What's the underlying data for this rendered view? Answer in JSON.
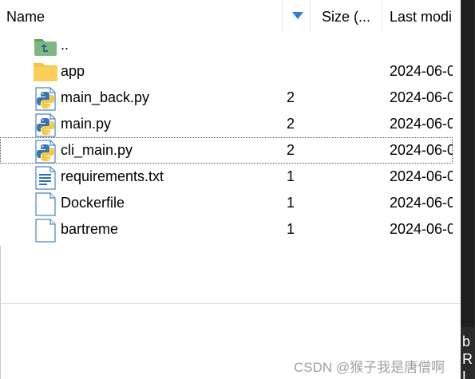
{
  "header": {
    "name_label": "Name",
    "size_label": "Size (...",
    "modified_label": "Last modi"
  },
  "files": [
    {
      "icon": "parent-folder-icon",
      "name": "..",
      "size": "",
      "modified": ""
    },
    {
      "icon": "folder-icon",
      "name": "app",
      "size": "",
      "modified": "2024-06-0"
    },
    {
      "icon": "python-file-icon",
      "name": "main_back.py",
      "size": "2",
      "modified": "2024-06-0"
    },
    {
      "icon": "python-file-icon",
      "name": "main.py",
      "size": "2",
      "modified": "2024-06-0"
    },
    {
      "icon": "python-file-icon",
      "name": "cli_main.py",
      "size": "2",
      "modified": "2024-06-0"
    },
    {
      "icon": "text-file-icon",
      "name": "requirements.txt",
      "size": "1",
      "modified": "2024-06-0"
    },
    {
      "icon": "blank-file-icon",
      "name": "Dockerfile",
      "size": "1",
      "modified": "2024-06-0"
    },
    {
      "icon": "blank-file-icon",
      "name": "bartreme",
      "size": "1",
      "modified": "2024-06-0"
    }
  ],
  "focused_index": 4,
  "side_text": [
    "b",
    "R",
    "L"
  ],
  "watermark": "CSDN @猴子我是唐僧啊",
  "colors": {
    "folder": "#f5c242",
    "python_blue": "#3a75b0",
    "python_yellow": "#f7c93e",
    "sort_arrow": "#2f7fd3",
    "parent_folder": "#7cb982"
  }
}
